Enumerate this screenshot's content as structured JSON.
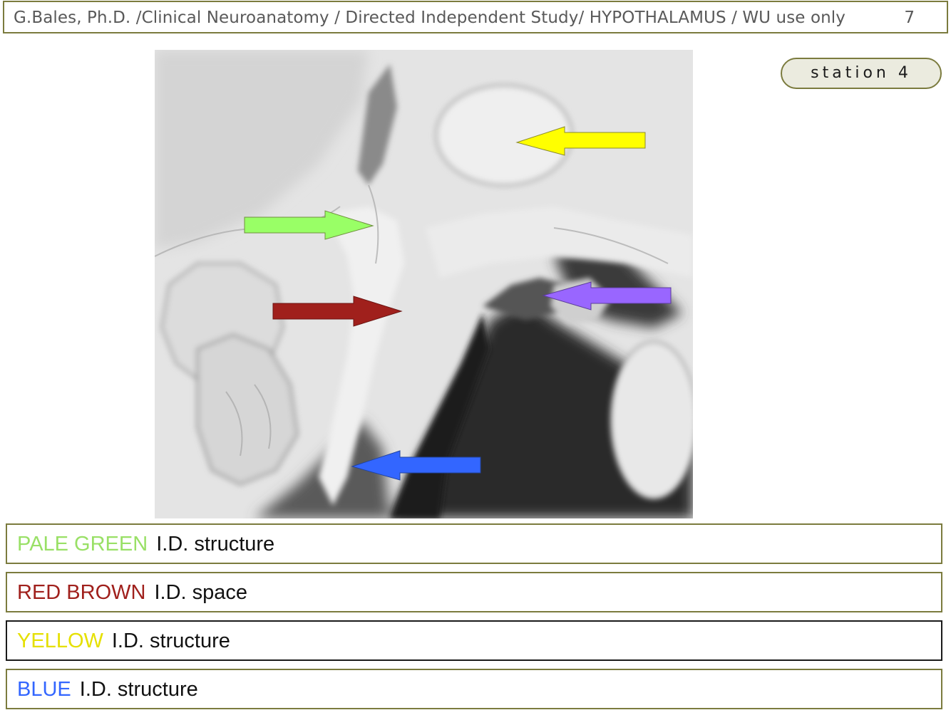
{
  "header": {
    "title": "G.Bales, Ph.D. /Clinical Neuroanatomy / Directed Independent  Study/ HYPOTHALAMUS / WU use only",
    "page_number": "7"
  },
  "station": {
    "label": "station 4"
  },
  "figure": {
    "arrows": [
      {
        "name": "yellow-arrow",
        "color": "#ffff00",
        "direction": "left"
      },
      {
        "name": "pale-green-arrow",
        "color": "#99ff66",
        "direction": "right"
      },
      {
        "name": "red-brown-arrow",
        "color": "#a0201c",
        "direction": "right"
      },
      {
        "name": "purple-arrow",
        "color": "#9966ff",
        "direction": "left"
      },
      {
        "name": "blue-arrow",
        "color": "#3366ff",
        "direction": "left"
      }
    ]
  },
  "questions": [
    {
      "color_word": "PALE GREEN",
      "color": "#99e066",
      "prompt": "I.D. structure"
    },
    {
      "color_word": "RED BROWN",
      "color": "#a0201c",
      "prompt": "I.D. space"
    },
    {
      "color_word": "YELLOW",
      "color": "#e5e000",
      "prompt": "I.D. structure"
    },
    {
      "color_word": "BLUE",
      "color": "#3366ff",
      "prompt": "I.D. structure"
    }
  ]
}
